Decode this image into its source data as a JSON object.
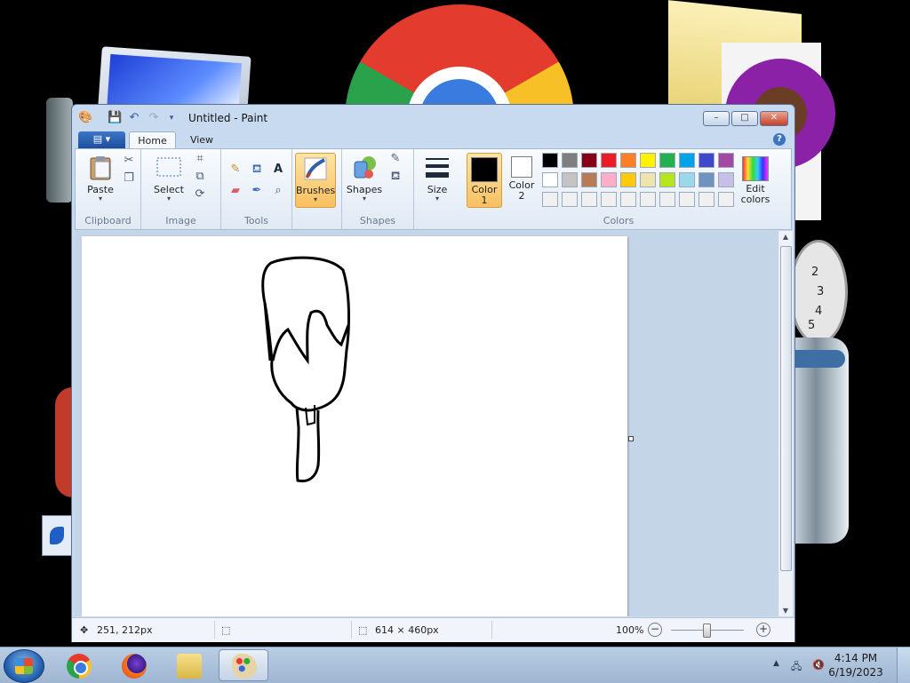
{
  "window": {
    "title": "Untitled - Paint",
    "controls": {
      "minimize": "–",
      "maximize": "□",
      "close": "✕"
    }
  },
  "ribbon": {
    "file_menu": "▤ ▾",
    "tabs": [
      "Home",
      "View"
    ],
    "active_tab": "Home",
    "help": "?",
    "groups": {
      "clipboard": {
        "label": "Clipboard",
        "paste": "Paste"
      },
      "image": {
        "label": "Image",
        "select": "Select"
      },
      "tools": {
        "label": "Tools"
      },
      "brushes": {
        "label": "Brushes"
      },
      "shapes": {
        "label": "Shapes",
        "shapes": "Shapes"
      },
      "size": {
        "label": "Size"
      },
      "colors": {
        "label": "Colors",
        "color1": "Color\n1",
        "color1_value": "#000000",
        "color2": "Color\n2",
        "color2_value": "#ffffff",
        "edit_colors": "Edit\ncolors",
        "palette_row1": [
          "#000000",
          "#7f7f7f",
          "#880015",
          "#ed1c24",
          "#ff7f27",
          "#fff200",
          "#22b14c",
          "#00a2e8",
          "#3f48cc",
          "#a349a4"
        ],
        "palette_row2": [
          "#ffffff",
          "#c3c3c3",
          "#b97a57",
          "#ffaec9",
          "#ffc90e",
          "#efe4b0",
          "#b5e61d",
          "#99d9ea",
          "#7092be",
          "#c8bfe7"
        ],
        "palette_row3": [
          "#f0f0f0",
          "#f0f0f0",
          "#f0f0f0",
          "#f0f0f0",
          "#f0f0f0",
          "#f0f0f0",
          "#f0f0f0",
          "#f0f0f0",
          "#f0f0f0",
          "#f0f0f0"
        ]
      }
    }
  },
  "status": {
    "cursor_position": "251, 212px",
    "selection_size": "",
    "canvas_size": "614 × 460px",
    "zoom": "100%",
    "zoom_level": 1.0
  },
  "taskbar": {
    "apps": [
      "chrome",
      "firefox",
      "file-explorer",
      "paint"
    ],
    "active_app": "paint",
    "time": "4:14 PM",
    "date": "6/19/2023"
  },
  "desktop": {
    "clock_numbers": [
      "2",
      "3",
      "4",
      "5"
    ]
  }
}
